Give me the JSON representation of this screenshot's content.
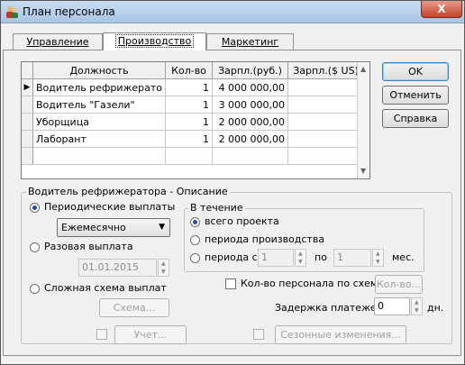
{
  "window": {
    "title": "План персонала",
    "close_glyph": "X"
  },
  "tabs": [
    {
      "label": "Управление"
    },
    {
      "label": "Производство"
    },
    {
      "label": "Маркетинг"
    }
  ],
  "table": {
    "columns": [
      "Должность",
      "Кол-во",
      "Зарпл.(руб.)",
      "Зарпл.($ US)"
    ],
    "rows": [
      {
        "name": "Водитель рефрижерато",
        "qty": "1",
        "rub": "4 000 000,00",
        "usd": ""
      },
      {
        "name": "Водитель \"Газели\"",
        "qty": "1",
        "rub": "3 000 000,00",
        "usd": ""
      },
      {
        "name": "Уборщица",
        "qty": "1",
        "rub": "2 000 000,00",
        "usd": ""
      },
      {
        "name": "Лаборант",
        "qty": "1",
        "rub": "2 000 000,00",
        "usd": ""
      }
    ],
    "current_row_marker": "▶"
  },
  "buttons": {
    "ok": "OK",
    "cancel": "Отменить",
    "help": "Справка"
  },
  "description": {
    "title": "Водитель рефрижератора - Описание",
    "periodic": "Периодические выплаты",
    "frequency": "Ежемесячно",
    "one_time": "Разовая выплата",
    "date": "01.01.2015",
    "complex": "Сложная схема выплат",
    "scheme_btn": "Схема..."
  },
  "period": {
    "title": "В течение",
    "whole": "всего проекта",
    "production": "периода производства",
    "from": "периода с",
    "from_value": "1",
    "to": "по",
    "to_value": "1",
    "unit": "мес."
  },
  "staff_by_scheme": {
    "label": "Кол-во персонала по схеме",
    "btn": "Кол-во..."
  },
  "delay": {
    "label": "Задержка платежей:",
    "value": "0",
    "unit": "дн."
  },
  "bottom": {
    "accounting": "Учет...",
    "seasonal": "Сезонные изменения..."
  },
  "icons": {
    "app": "people-icon",
    "combo": "chevron-down-icon",
    "spin_up": "spin-up-icon",
    "spin_down": "spin-down-icon",
    "scroll_up": "scroll-up-icon",
    "scroll_down": "scroll-down-icon"
  },
  "colors": {
    "desktop": "#2b5f93",
    "close": "#c4452c"
  }
}
